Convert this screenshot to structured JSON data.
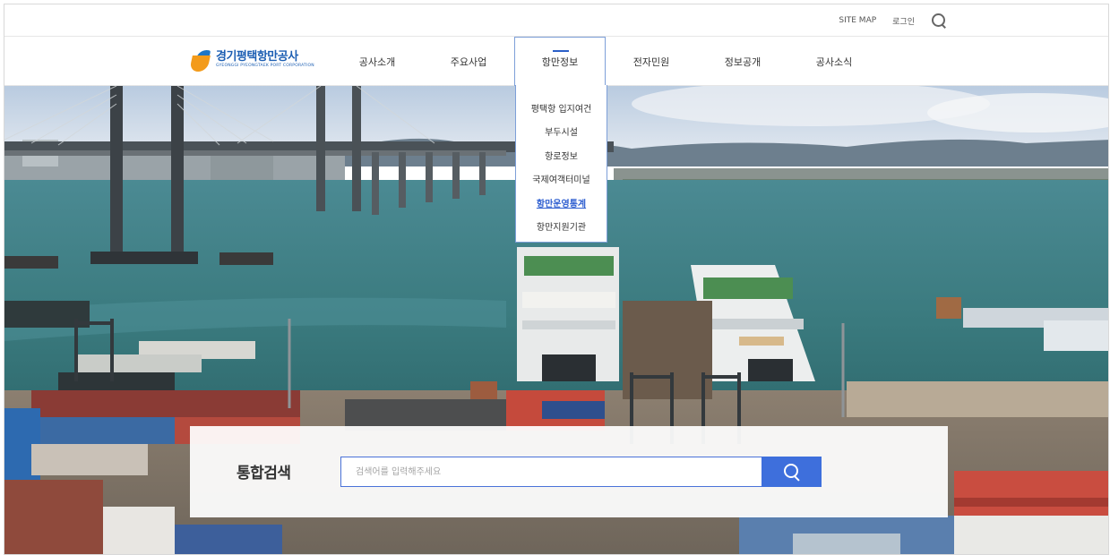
{
  "utility": {
    "sitemap": "SITE MAP",
    "login": "로그인",
    "search_icon": "search-icon"
  },
  "logo": {
    "name_ko": "경기평택항만공사",
    "name_en": "GYEONGGI PYEONGTAEK PORT CORPORATION"
  },
  "gnb": {
    "items": [
      {
        "label": "공사소개"
      },
      {
        "label": "주요사업"
      },
      {
        "label": "항만정보"
      },
      {
        "label": "전자민원"
      },
      {
        "label": "정보공개"
      },
      {
        "label": "공사소식"
      }
    ],
    "active_index": 2
  },
  "dropdown": {
    "items": [
      {
        "label": "평택항 입지여건"
      },
      {
        "label": "부두시설"
      },
      {
        "label": "항로정보"
      },
      {
        "label": "국제여객터미널"
      },
      {
        "label": "항만운영통계"
      },
      {
        "label": "항만지원기관"
      }
    ],
    "active_index": 4
  },
  "search": {
    "label": "통합검색",
    "placeholder": "검색어를 입력해주세요"
  },
  "colors": {
    "accent": "#3e6fdc",
    "active_text": "#2f5fd0",
    "logo_blue": "#1d5fb3",
    "logo_orange": "#f39b1b"
  }
}
